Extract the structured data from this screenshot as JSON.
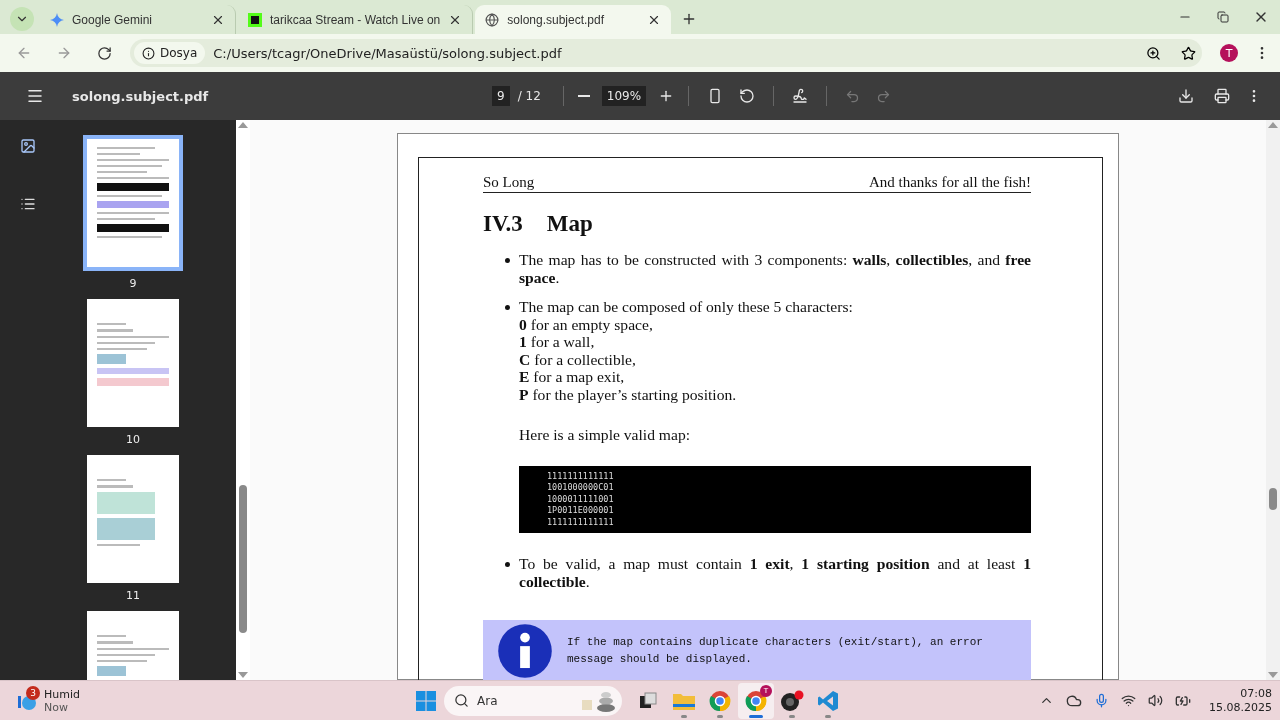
{
  "browser": {
    "tabs": [
      {
        "kind": "spark",
        "title": "Google Gemini",
        "selected": false
      },
      {
        "kind": "square",
        "title": "tarikcaa Stream - Watch Live on",
        "selected": false
      },
      {
        "kind": "globe",
        "title": "solong.subject.pdf",
        "selected": true
      }
    ],
    "address": {
      "badge": "Dosya",
      "url": "C:/Users/tcagr/OneDrive/Masaüstü/solong.subject.pdf"
    },
    "avatar": "T"
  },
  "pdf_toolbar": {
    "title": "solong.subject.pdf",
    "page": "9",
    "total": "/ 12",
    "zoom": "109%"
  },
  "sidebar": {
    "modes": [
      {
        "kind": "thumbnails",
        "selected": true
      },
      {
        "kind": "outline",
        "selected": false
      }
    ],
    "thumbnails": [
      {
        "label": "9",
        "selected": true,
        "kind": "text"
      },
      {
        "label": "10",
        "selected": false,
        "kind": "chapter"
      },
      {
        "label": "11",
        "selected": false,
        "kind": "images"
      },
      {
        "selected": false,
        "kind": "chapter"
      }
    ]
  },
  "document": {
    "header_left": "So Long",
    "header_right": "And thanks for all the fish!",
    "heading_number": "IV.3",
    "heading": "Map",
    "bullets": [
      {
        "text": "The map has to be constructed with 3 components: **walls**, **collectibles**, and **free space**."
      },
      {
        "text": "The map can be composed of only these 5 characters:",
        "lines": [
          "**0** for an empty space,",
          "**1** for a wall,",
          "**C** for a collectible,",
          "**E** for a map exit,",
          "**P** for the player’s starting position."
        ],
        "after": "Here is a simple valid map:",
        "code": [
          "1111111111111",
          "1001000000C01",
          "1000011111001",
          "1P0011E000001",
          "1111111111111"
        ]
      },
      {
        "text": "To be valid, a map must contain **1 exit**, **1 starting position** and at least **1 collectible**."
      }
    ],
    "note": "If the map contains duplicate characters (exit/start), an error message should be displayed."
  },
  "taskbar": {
    "weather": {
      "badge": "3",
      "title": "Humid",
      "subtitle": "Now"
    },
    "search": {
      "placeholder": "Ara"
    },
    "apps": [
      {
        "kind": "task-view",
        "running": false,
        "selected": false
      },
      {
        "kind": "folder",
        "running": true,
        "selected": false
      },
      {
        "kind": "browser",
        "running": true,
        "selected": false
      },
      {
        "kind": "browser",
        "badge": "T",
        "running": true,
        "selected": true
      },
      {
        "kind": "recorder",
        "running": true,
        "selected": false
      },
      {
        "kind": "editor",
        "running": true,
        "selected": false
      }
    ],
    "time": "07:08",
    "date": "15.08.2025"
  }
}
